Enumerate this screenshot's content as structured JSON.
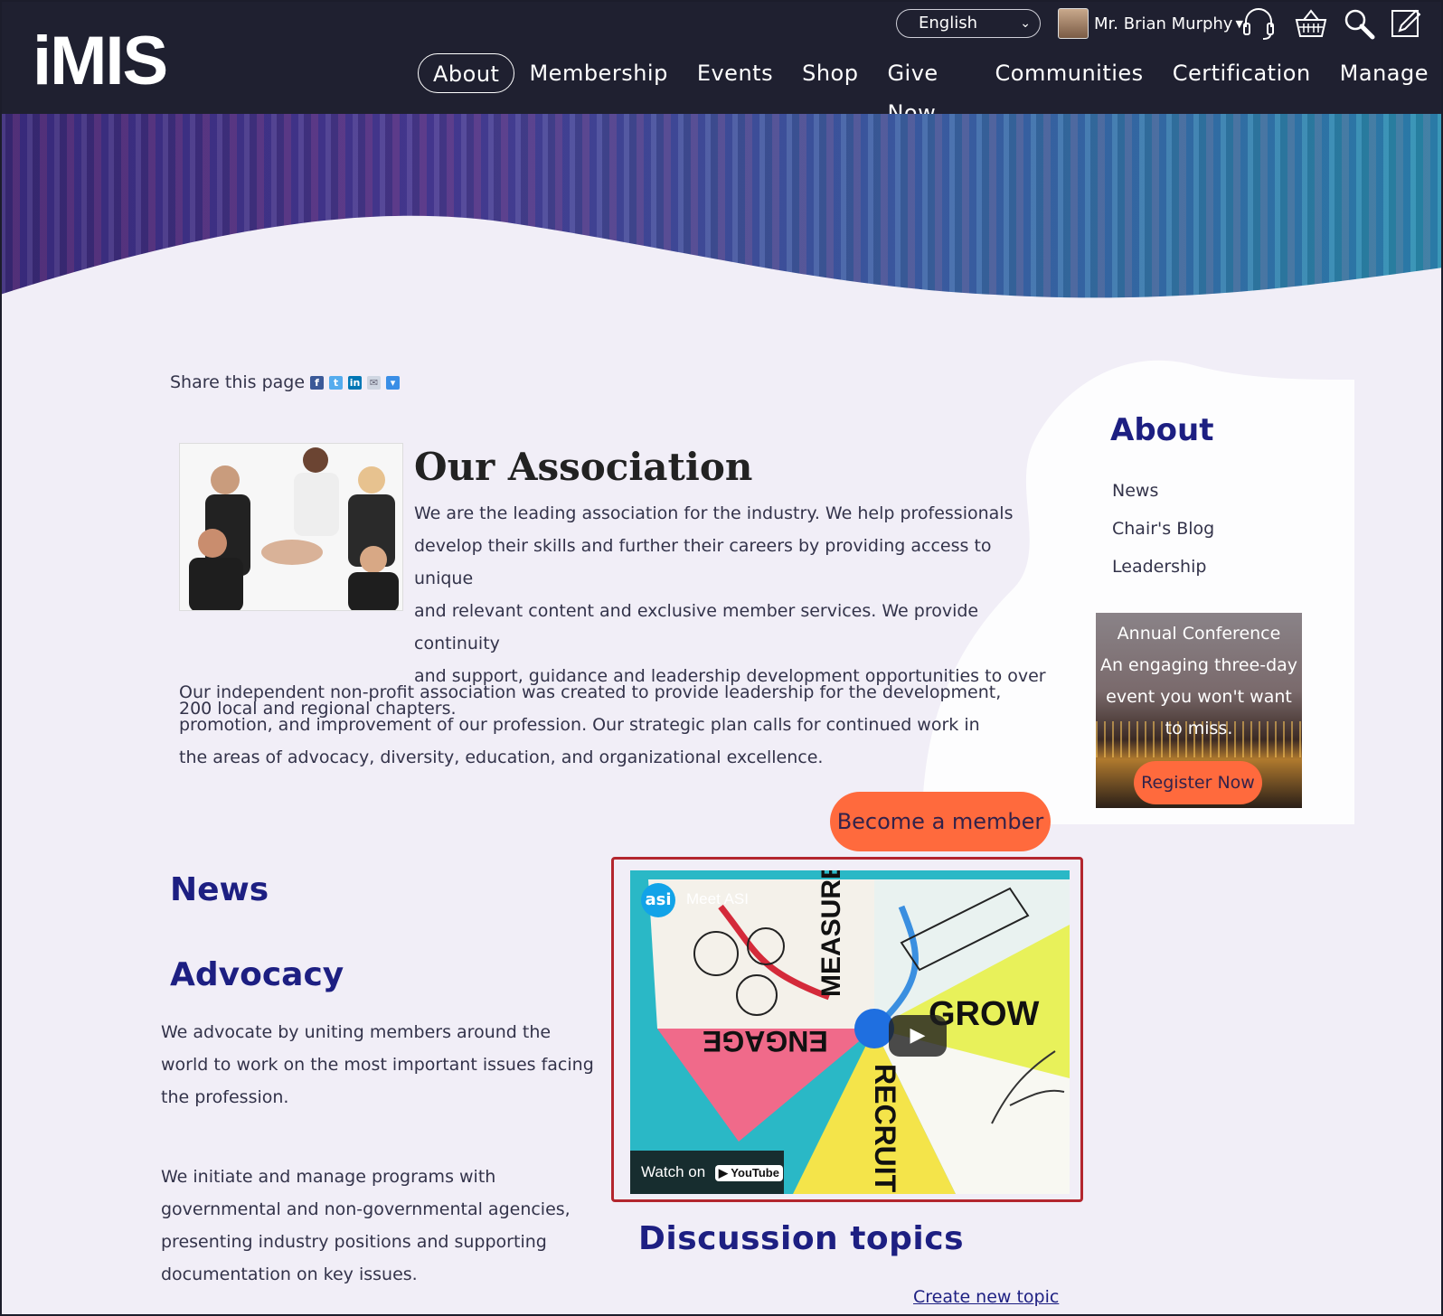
{
  "header": {
    "logo": "iMIS",
    "language": "English",
    "user_name": "Mr. Brian Murphy",
    "icons": [
      "headset-icon",
      "basket-icon",
      "search-icon",
      "edit-icon"
    ],
    "nav": [
      {
        "label": "About",
        "active": true
      },
      {
        "label": "Membership"
      },
      {
        "label": "Events"
      },
      {
        "label": "Shop"
      },
      {
        "label": "Give Now"
      },
      {
        "label": "Communities"
      },
      {
        "label": "Certification"
      },
      {
        "label": "Manage"
      }
    ]
  },
  "share": {
    "label": "Share this page"
  },
  "main": {
    "title": "Our Association",
    "para1": "We are the leading association for the industry. We help professionals develop their skills and further their careers by providing access to unique and relevant content and exclusive member services. We provide continuity and support, guidance and leadership development opportunities to over 200 local and regional chapters.",
    "para1_lines": [
      "We are the leading association for the industry. We help professionals",
      "develop their skills and further their careers by providing access to unique",
      "and relevant content and exclusive member services. We provide continuity",
      "and support, guidance and leadership development opportunities to over",
      "200 local and regional chapters."
    ],
    "para2": "Our independent non-profit association was created to provide leadership for the development, promotion, and improvement of our profession. Our strategic plan calls for continued work in the areas of advocacy, diversity, education, and organizational excellence.",
    "become_member": "Become a member",
    "news_heading": "News",
    "advocacy_heading": "Advocacy",
    "advocacy_p1": "We advocate by uniting members around the world to work on the most important issues facing the profession.",
    "advocacy_p2": "We initiate and manage programs with governmental and non-governmental agencies, presenting industry positions and supporting documentation on key issues.",
    "discussion_heading": "Discussion topics",
    "create_topic": "Create new topic"
  },
  "video": {
    "channel_logo": "asi",
    "title": "Meet ASI",
    "watch_on": "Watch on",
    "youtube": "YouTube",
    "words": [
      "MEASURE",
      "GROW",
      "ENGAGE",
      "RECRUIT"
    ]
  },
  "sidebar": {
    "heading": "About",
    "links": [
      "News",
      "Chair's Blog",
      "Leadership"
    ],
    "promo": {
      "title": "Annual Conference",
      "text": "An engaging three-day event you won't want to miss.",
      "button": "Register Now"
    }
  },
  "colors": {
    "header_bg": "#1f2030",
    "page_bg": "#f1eef7",
    "heading_blue": "#1d1f82",
    "accent_orange": "#ff6a3d",
    "video_border": "#b3262e"
  }
}
